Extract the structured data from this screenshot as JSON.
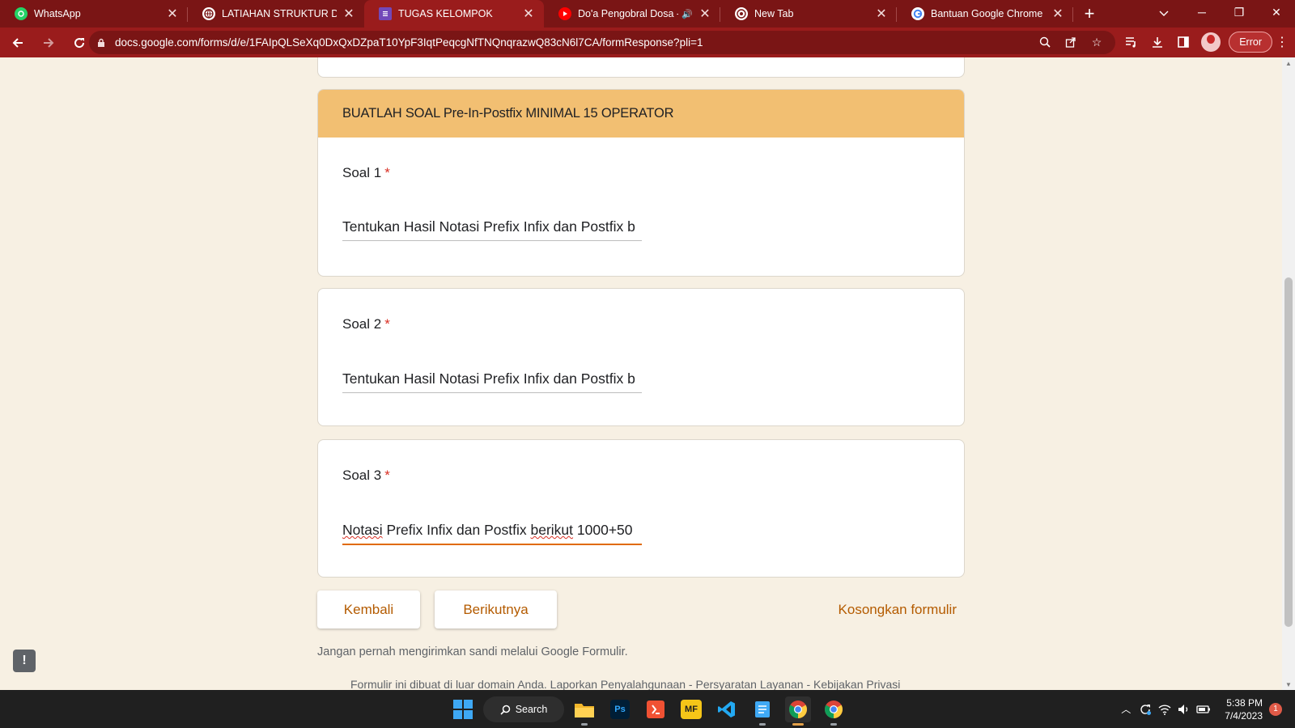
{
  "browser": {
    "tabs": [
      {
        "title": "WhatsApp",
        "icon": "whatsapp-icon",
        "color": "#25d366",
        "active": false,
        "audio": false
      },
      {
        "title": "LATIAHAN STRUKTUR DATA.p",
        "icon": "globe-icon",
        "color": "#ffffff",
        "active": false,
        "audio": false
      },
      {
        "title": "TUGAS KELOMPOK",
        "icon": "google-forms-icon",
        "color": "#7248b9",
        "active": true,
        "audio": false
      },
      {
        "title": "Do'a Pengobral Dosa - Yo",
        "icon": "youtube-icon",
        "color": "#ff0000",
        "active": false,
        "audio": true
      },
      {
        "title": "New Tab",
        "icon": "chrome-icon",
        "color": "#ffffff",
        "active": false,
        "audio": false
      },
      {
        "title": "Bantuan Google Chrome",
        "icon": "google-icon",
        "color": "#ffffff",
        "active": false,
        "audio": false
      }
    ],
    "new_tab_symbol": "+",
    "url": "docs.google.com/forms/d/e/1FAIpQLSeXq0DxQxDZpaT10YpF3IqtPeqcgNfTNQnqrazwQ83cN6l7CA/formResponse?pli=1",
    "profile_status": "Error",
    "theme_color": "#9a1c1c"
  },
  "form": {
    "section_title": "BUATLAH SOAL   Pre-In-Postfix MINIMAL 15 OPERATOR",
    "section_color": "#f2bf72",
    "required_mark": "*",
    "questions": [
      {
        "label": "Soal 1",
        "answer": "Tentukan Hasil Notasi Prefix Infix dan Postfix b"
      },
      {
        "label": "Soal 2",
        "answer": "Tentukan Hasil Notasi Prefix Infix dan Postfix b"
      },
      {
        "label": "Soal 3",
        "answer_words": [
          "Notasi",
          "Prefix Infix dan Postfix",
          "berikut",
          "1000+50"
        ]
      }
    ],
    "buttons": {
      "back": "Kembali",
      "next": "Berikutnya",
      "clear": "Kosongkan formulir"
    },
    "accent_color": "#b45b00",
    "password_warning": "Jangan pernah mengirimkan sandi melalui Google Formulir.",
    "footer": "Formulir ini dibuat di luar domain Anda. Laporkan Penyalahgunaan - Persyaratan Layanan - Kebijakan Privasi",
    "feedback_icon": "!"
  },
  "taskbar": {
    "search_label": "Search",
    "apps": [
      "windows-start-icon",
      "file-explorer-icon",
      "photoshop-icon",
      "git-icon",
      "mf-icon",
      "vscode-icon",
      "notepad-icon",
      "chrome-icon",
      "chrome-profile-icon"
    ],
    "photoshop_label": "Ps",
    "mf_label": "MF",
    "time": "5:38 PM",
    "date": "7/4/2023",
    "notification_count": "1"
  }
}
